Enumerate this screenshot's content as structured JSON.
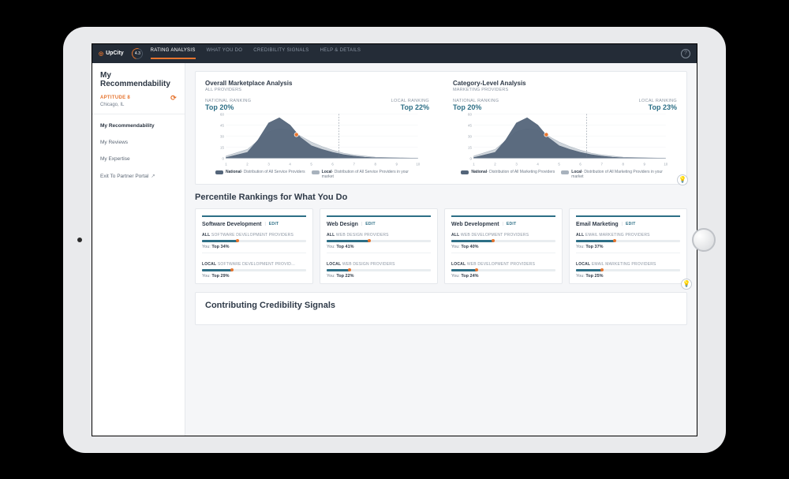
{
  "brand": {
    "name": "UpCity",
    "score": "4.3"
  },
  "tabs": [
    {
      "id": "rating",
      "label": "RATING ANALYSIS",
      "active": true
    },
    {
      "id": "what",
      "label": "WHAT YOU DO"
    },
    {
      "id": "cred",
      "label": "CREDIBILITY SIGNALS"
    },
    {
      "id": "help",
      "label": "HELP & DETAILS"
    }
  ],
  "sidebar": {
    "title": "My Recommendability",
    "company": "APTITUDE 8",
    "city": "Chicago, IL",
    "items": [
      {
        "id": "rec",
        "label": "My Recommendability",
        "active": true
      },
      {
        "id": "rev",
        "label": "My Reviews"
      },
      {
        "id": "exp",
        "label": "My Expertise"
      },
      {
        "id": "exit",
        "label": "Exit To Partner Portal",
        "external": true
      }
    ]
  },
  "analysis": {
    "overall": {
      "title": "Overall Marketplace Analysis",
      "sub": "ALL PROVIDERS",
      "national_label": "NATIONAL RANKING",
      "national_val": "Top 20%",
      "local_label": "LOCAL RANKING",
      "local_val": "Top 22%",
      "legend_nat_b": "National",
      "legend_nat": "- Distribution of All Service Providers",
      "legend_loc_b": "Local",
      "legend_loc": "- Distribution of All Service Providers in your market"
    },
    "category": {
      "title": "Category-Level Analysis",
      "sub": "MARKETING PROVIDERS",
      "national_label": "NATIONAL RANKING",
      "national_val": "Top 20%",
      "local_label": "LOCAL RANKING",
      "local_val": "Top 23%",
      "legend_nat_b": "National",
      "legend_nat": "- Distribution of All Marketing Providers",
      "legend_loc_b": "Local",
      "legend_loc": "- Distribution of All Marketing Providers in your market"
    }
  },
  "chart_data": [
    {
      "type": "area",
      "title": "Overall Marketplace Analysis",
      "xlabel": "",
      "ylabel": "",
      "x_ticks": [
        1,
        2,
        3,
        4,
        5,
        6,
        7,
        8,
        9,
        10
      ],
      "y_ticks": [
        0,
        15,
        30,
        45,
        60
      ],
      "ylim": [
        0,
        60
      ],
      "marker_x": 4.3,
      "dashed_x": 6.3,
      "series": [
        {
          "name": "National",
          "color": "#54657a",
          "x": [
            1,
            2,
            2.5,
            3,
            3.5,
            4,
            4.5,
            5,
            5.5,
            6,
            6.5,
            7,
            7.5,
            8,
            10
          ],
          "y": [
            1,
            8,
            25,
            48,
            55,
            45,
            28,
            17,
            12,
            8,
            5,
            3,
            1.5,
            0.7,
            0
          ]
        },
        {
          "name": "Local",
          "color": "#a8b2bd",
          "x": [
            1,
            2,
            2.5,
            3,
            3.5,
            4,
            4.5,
            5,
            5.5,
            6,
            6.5,
            7,
            8,
            10
          ],
          "y": [
            3,
            12,
            24,
            36,
            40,
            38,
            30,
            22,
            16,
            11,
            7,
            4.5,
            1.5,
            0
          ]
        }
      ]
    },
    {
      "type": "area",
      "title": "Category-Level Analysis",
      "xlabel": "",
      "ylabel": "",
      "x_ticks": [
        1,
        2,
        3,
        4,
        5,
        6,
        7,
        8,
        9,
        10
      ],
      "y_ticks": [
        0,
        15,
        30,
        45,
        60
      ],
      "ylim": [
        0,
        60
      ],
      "marker_x": 4.4,
      "dashed_x": 6.3,
      "series": [
        {
          "name": "National",
          "color": "#54657a",
          "x": [
            1,
            2,
            2.5,
            3,
            3.5,
            4,
            4.5,
            5,
            5.5,
            6,
            6.5,
            7,
            7.5,
            8,
            10
          ],
          "y": [
            1,
            8,
            25,
            48,
            55,
            45,
            28,
            17,
            12,
            8,
            5,
            3,
            1.5,
            0.7,
            0
          ]
        },
        {
          "name": "Local",
          "color": "#a8b2bd",
          "x": [
            1,
            2,
            2.5,
            3,
            3.5,
            4,
            4.5,
            5,
            5.5,
            6,
            6.5,
            7,
            8,
            10
          ],
          "y": [
            3,
            12,
            24,
            36,
            40,
            38,
            30,
            22,
            16,
            11,
            7,
            4.5,
            1.5,
            0
          ]
        }
      ]
    }
  ],
  "percentile": {
    "heading": "Percentile Rankings for What You Do",
    "edit": "EDIT",
    "you_prefix": "You:",
    "cards": [
      {
        "title": "Software Development",
        "all_scope": "SOFTWARE DEVELOPMENT PROVIDERS",
        "all_pct": 34,
        "all_val": "Top 34%",
        "local_scope": "SOFTWARE DEVELOPMENT PROVID…",
        "local_pct": 29,
        "local_val": "Top 29%"
      },
      {
        "title": "Web Design",
        "all_scope": "WEB DESIGN PROVIDERS",
        "all_pct": 41,
        "all_val": "Top 41%",
        "local_scope": "WEB DESIGN PROVIDERS",
        "local_pct": 22,
        "local_val": "Top 22%"
      },
      {
        "title": "Web Development",
        "all_scope": "WEB DEVELOPMENT PROVIDERS",
        "all_pct": 40,
        "all_val": "Top 40%",
        "local_scope": "WEB DEVELOPMENT PROVIDERS",
        "local_pct": 24,
        "local_val": "Top 24%"
      },
      {
        "title": "Email Marketing",
        "all_scope": "EMAIL MARKETING PROVIDERS",
        "all_pct": 37,
        "all_val": "Top 37%",
        "local_scope": "EMAIL MARKETING PROVIDERS",
        "local_pct": 25,
        "local_val": "Top 25%"
      }
    ]
  },
  "cred": {
    "heading": "Contributing Credibility Signals"
  },
  "labels": {
    "all": "ALL",
    "local": "LOCAL"
  }
}
